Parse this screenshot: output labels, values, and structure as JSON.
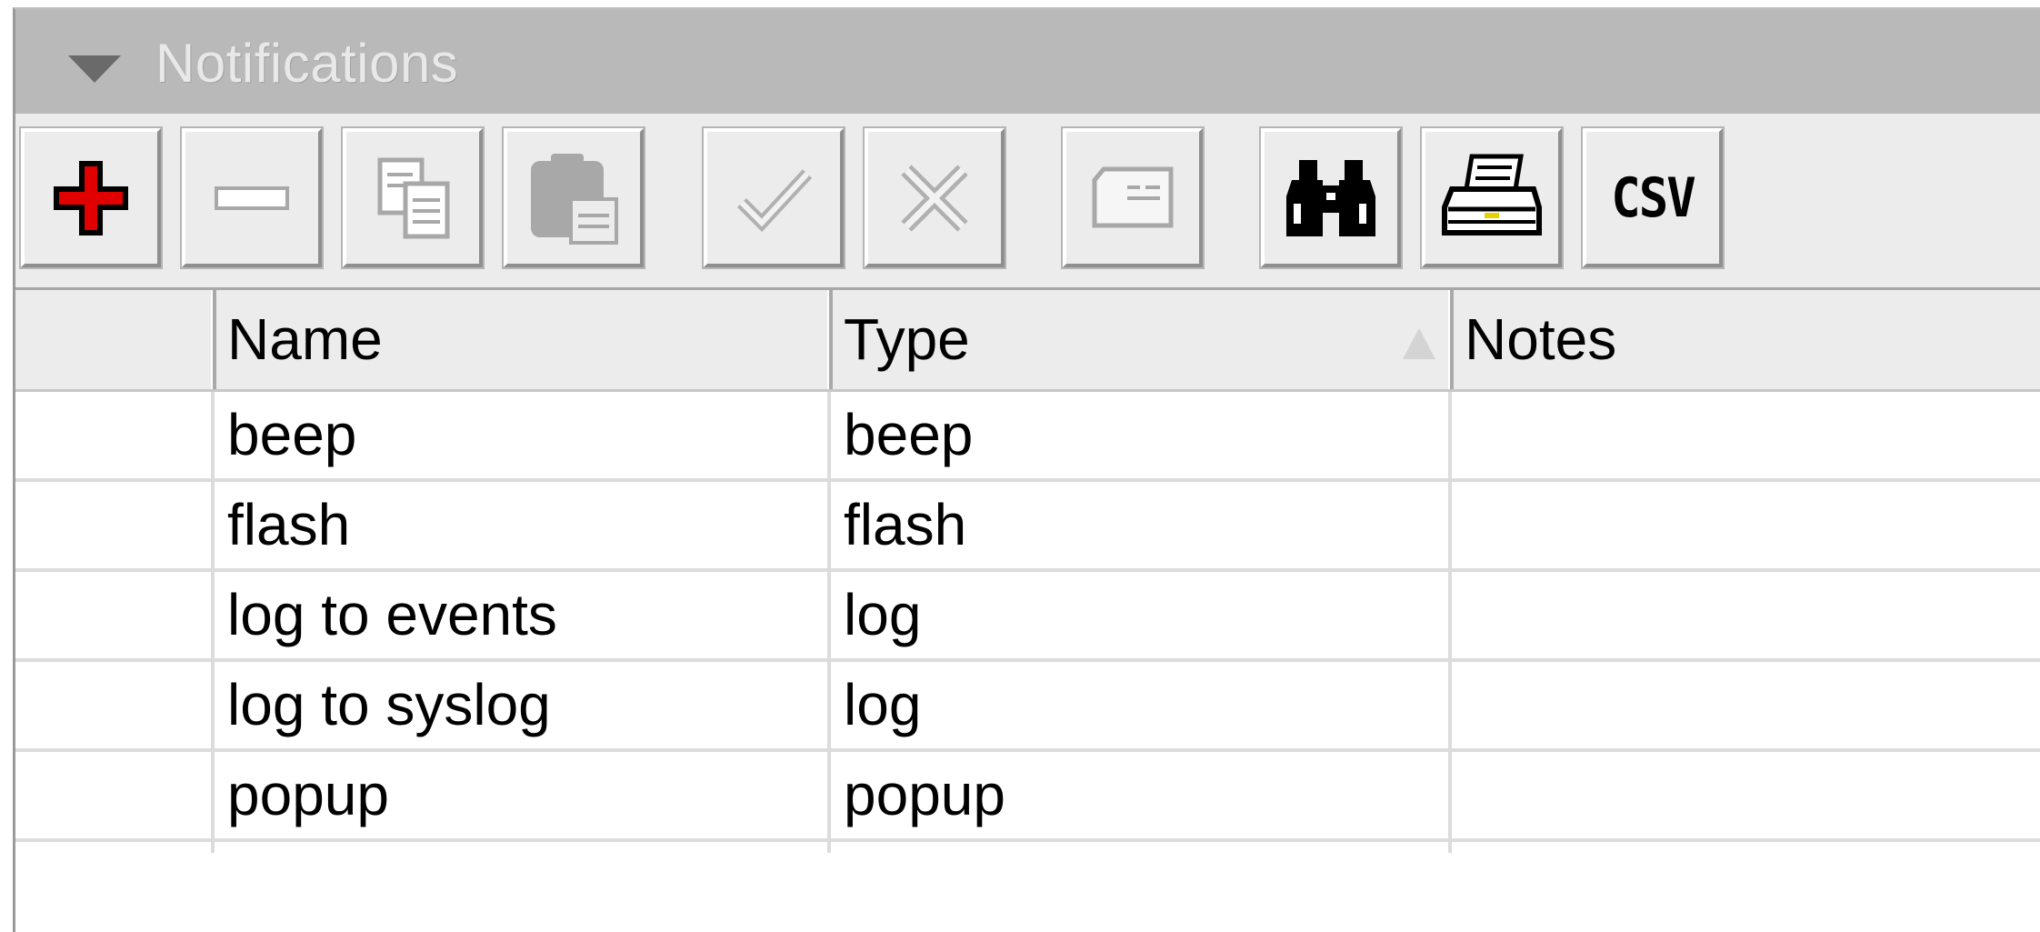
{
  "window": {
    "title": "Notifications"
  },
  "toolbar": {
    "buttons": [
      {
        "name": "add",
        "icon": "plus-icon",
        "enabled": true
      },
      {
        "name": "remove",
        "icon": "minus-icon",
        "enabled": false
      },
      {
        "name": "copy",
        "icon": "copy-icon",
        "enabled": false
      },
      {
        "name": "paste",
        "icon": "paste-icon",
        "enabled": false
      },
      {
        "name": "enable",
        "icon": "check-icon",
        "enabled": false
      },
      {
        "name": "disable",
        "icon": "x-icon",
        "enabled": false
      },
      {
        "name": "comment",
        "icon": "note-icon",
        "enabled": false
      },
      {
        "name": "find",
        "icon": "binoculars-icon",
        "enabled": true
      },
      {
        "name": "print",
        "icon": "printer-icon",
        "enabled": true
      },
      {
        "name": "export-csv",
        "label": "CSV",
        "enabled": true
      }
    ],
    "csv_label": "CSV"
  },
  "table": {
    "columns": [
      "Name",
      "Type",
      "Notes"
    ],
    "sorted_column": "Type",
    "rows": [
      {
        "name": "beep",
        "type": "beep",
        "notes": ""
      },
      {
        "name": "flash",
        "type": "flash",
        "notes": ""
      },
      {
        "name": "log to events",
        "type": "log",
        "notes": ""
      },
      {
        "name": "log to syslog",
        "type": "log",
        "notes": ""
      },
      {
        "name": "popup",
        "type": "popup",
        "notes": ""
      }
    ]
  },
  "colors": {
    "add_icon": "#e00000",
    "titlebar": "#b9b9b9",
    "disabled_icon": "#a8a8a8"
  }
}
